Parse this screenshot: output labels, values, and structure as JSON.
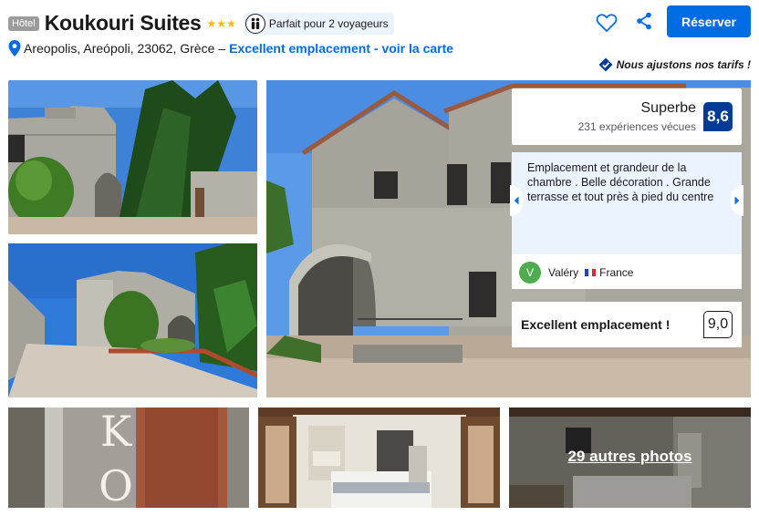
{
  "header": {
    "type_badge": "Hôtel",
    "title": "Koukouri Suites",
    "stars": "★★★",
    "travelers_badge": "Parfait pour 2 voyageurs",
    "address": "Areopolis, Areópoli, 23062, Grèce",
    "address_separator": "–",
    "location_link": "Excellent emplacement - voir la carte",
    "reserve_label": "Réserver",
    "price_match": "Nous ajustons nos tarifs !"
  },
  "review_panel": {
    "rating_word": "Superbe",
    "review_count": "231 expériences vécues",
    "score": "8,6",
    "quote": "Emplacement et grandeur de la chambre . Belle décoration . Grande terrasse et tout près à pied du centre",
    "reviewer_initial": "V",
    "reviewer_name": "Valéry",
    "reviewer_country": "France",
    "location_label": "Excellent emplacement !",
    "location_score": "9,0"
  },
  "gallery": {
    "more_photos": "29 autres photos"
  },
  "colors": {
    "brand_blue": "#006ce4",
    "dark_blue": "#003b95",
    "star_yellow": "#febb02",
    "avatar_green": "#4fab4f"
  },
  "icons": {
    "heart": "heart-icon",
    "share": "share-icon",
    "pin": "map-pin-icon",
    "travelers": "two-people-icon",
    "price_match": "thumbs-up-check-icon"
  }
}
